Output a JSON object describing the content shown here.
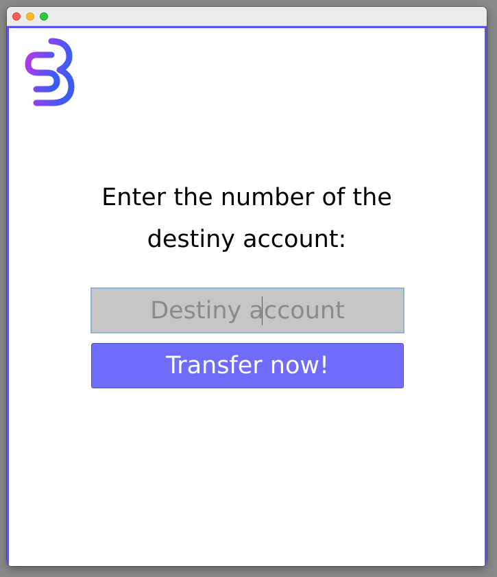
{
  "window": {
    "controls": [
      "close",
      "minimize",
      "maximize"
    ]
  },
  "logo": {
    "icon": "bank-logo-icon",
    "colors": [
      "#a13ce6",
      "#3d5ef5"
    ]
  },
  "prompt": {
    "line1": "Enter the number of the",
    "line2": "destiny account:"
  },
  "destiny_field": {
    "value": "",
    "placeholder": "Destiny account"
  },
  "transfer_button": {
    "label": "Transfer now!"
  },
  "colors": {
    "accent": "#5b55ee",
    "button": "#6e6cf8",
    "field_bg": "#c6c6c6"
  }
}
